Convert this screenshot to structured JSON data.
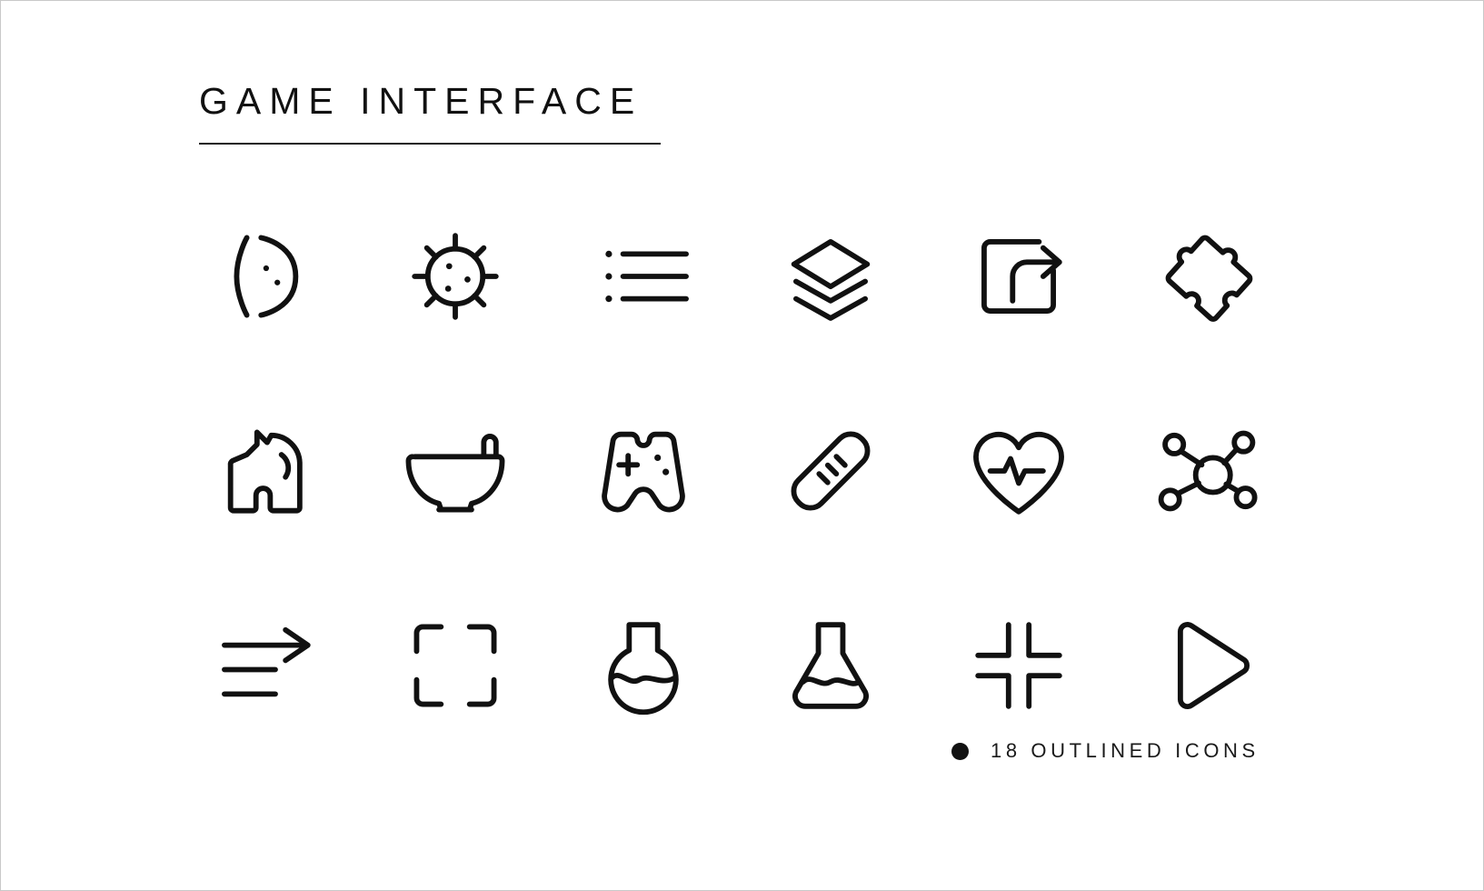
{
  "sheet": {
    "background": "#ffffff",
    "border_color": "#c9c9c9",
    "ink_color": "#111111"
  },
  "header": {
    "title": "GAME INTERFACE"
  },
  "footer": {
    "bullet": "bullet-dot",
    "label": "18 OUTLINED ICONS"
  },
  "grid": {
    "columns": 6,
    "rows": 3,
    "count": 18,
    "icons": [
      {
        "id": "moon-crescent",
        "name": "moon-crescent-icon",
        "label": "Moon"
      },
      {
        "id": "virus",
        "name": "virus-icon",
        "label": "Virus"
      },
      {
        "id": "bullet-list",
        "name": "bullet-list-icon",
        "label": "List"
      },
      {
        "id": "layers",
        "name": "layers-icon",
        "label": "Layers"
      },
      {
        "id": "share-export",
        "name": "share-export-icon",
        "label": "Share"
      },
      {
        "id": "puzzle-piece",
        "name": "puzzle-piece-icon",
        "label": "Puzzle"
      },
      {
        "id": "chess-knight",
        "name": "chess-knight-icon",
        "label": "Knight"
      },
      {
        "id": "mortar-pestle",
        "name": "mortar-pestle-icon",
        "label": "Mortar"
      },
      {
        "id": "gamepad",
        "name": "gamepad-icon",
        "label": "Gamepad"
      },
      {
        "id": "bandage",
        "name": "bandage-icon",
        "label": "Bandage"
      },
      {
        "id": "heart-pulse",
        "name": "heart-pulse-icon",
        "label": "Health"
      },
      {
        "id": "molecule",
        "name": "molecule-icon",
        "label": "Molecule"
      },
      {
        "id": "sort-forward",
        "name": "sort-forward-icon",
        "label": "Forward"
      },
      {
        "id": "crop-frame",
        "name": "crop-frame-icon",
        "label": "Crop"
      },
      {
        "id": "round-flask",
        "name": "round-flask-icon",
        "label": "Potion"
      },
      {
        "id": "erlenmeyer-flask",
        "name": "erlenmeyer-flask-icon",
        "label": "Flask"
      },
      {
        "id": "collapse-corners",
        "name": "collapse-corners-icon",
        "label": "Collapse"
      },
      {
        "id": "play-triangle",
        "name": "play-triangle-icon",
        "label": "Play"
      }
    ]
  }
}
